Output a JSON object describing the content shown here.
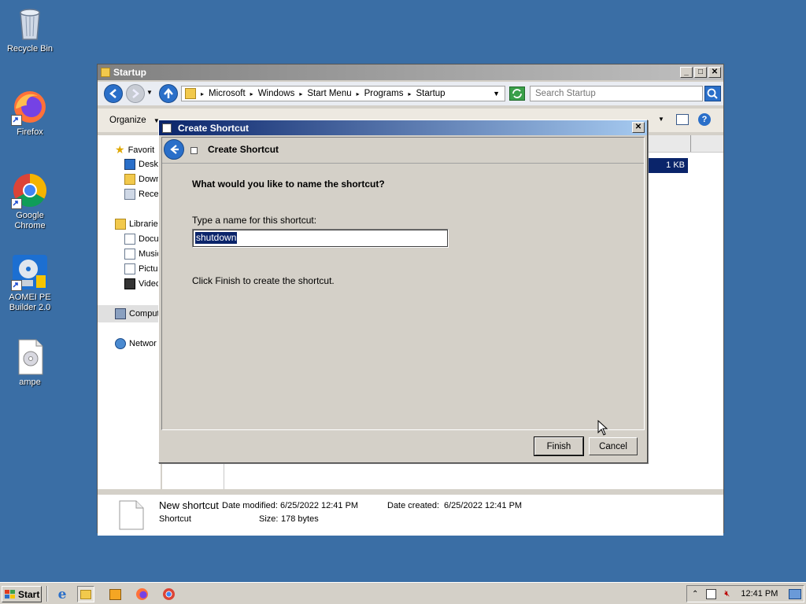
{
  "desktop": {
    "icons": [
      {
        "label": "Recycle Bin",
        "icon": "recycle-bin-icon"
      },
      {
        "label": "Firefox",
        "icon": "firefox-icon"
      },
      {
        "label": "Google Chrome",
        "icon": "chrome-icon"
      },
      {
        "label": "AOMEI PE Builder 2.0",
        "icon": "aomei-icon"
      },
      {
        "label": "ampe",
        "icon": "document-icon"
      }
    ]
  },
  "explorer": {
    "title": "Startup",
    "breadcrumbs": [
      "Microsoft",
      "Windows",
      "Start Menu",
      "Programs",
      "Startup"
    ],
    "search_placeholder": "Search Startup",
    "toolbar": {
      "organize": "Organize"
    },
    "nav": {
      "favorites": "Favorit",
      "desktop": "Deskt",
      "downloads": "Down",
      "recent": "Rece",
      "libraries": "Librarie",
      "documents": "Docu",
      "music": "Music",
      "pictures": "Pictur",
      "videos": "Videc",
      "computer": "Comput",
      "network": "Networ"
    },
    "file_size": "1 KB",
    "details": {
      "name": "New shortcut",
      "type": "Shortcut",
      "date_modified_label": "Date modified:",
      "date_modified": "6/25/2022 12:41 PM",
      "date_created_label": "Date created:",
      "date_created": "6/25/2022 12:41 PM",
      "size_label": "Size:",
      "size": "178 bytes"
    }
  },
  "dialog": {
    "title": "Create Shortcut",
    "header": "Create Shortcut",
    "question": "What would you like to name the shortcut?",
    "name_label": "Type a name for this shortcut:",
    "name_value": "shutdown",
    "hint": "Click Finish to create the shortcut.",
    "finish": "Finish",
    "cancel": "Cancel"
  },
  "taskbar": {
    "start": "Start",
    "clock": "12:41 PM"
  },
  "colors": {
    "desktop": "#3a6ea5",
    "titlebar_active": "#0a246a",
    "selection": "#0a246a"
  }
}
